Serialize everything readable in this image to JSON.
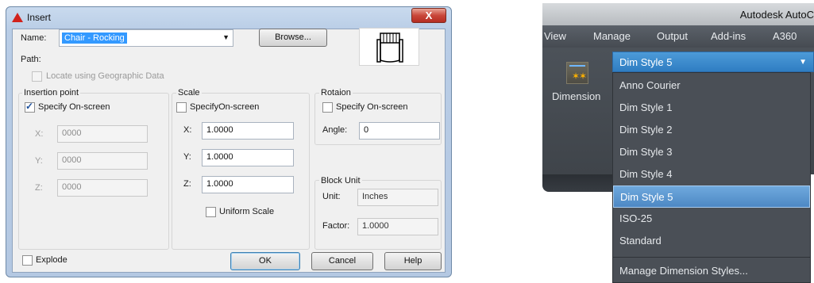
{
  "insert_dialog": {
    "title": "Insert",
    "close_glyph": "X",
    "name_label": "Name:",
    "name_value": "Chair - Rocking",
    "browse_button": "Browse...",
    "path_label": "Path:",
    "geo_checkbox": {
      "label": "Locate using Geographic Data",
      "checked": false,
      "enabled": false
    },
    "insertion_point": {
      "title": "Insertion point",
      "specify_label": "Specify On-screen",
      "specify_checked": true,
      "x_label": "X:",
      "x_value": "0000",
      "y_label": "Y:",
      "y_value": "0000",
      "z_label": "Z:",
      "z_value": "0000"
    },
    "scale": {
      "title": "Scale",
      "specify_label": "SpecifyOn-screen",
      "specify_checked": false,
      "x_label": "X:",
      "x_value": "1.0000",
      "y_label": "Y:",
      "y_value": "1.0000",
      "z_label": "Z:",
      "z_value": "1.0000",
      "uniform_label": "Uniform Scale",
      "uniform_checked": false
    },
    "rotation": {
      "title": "Rotaion",
      "specify_label": "Specify On-screen",
      "specify_checked": false,
      "angle_label": "Angle:",
      "angle_value": "0"
    },
    "block_unit": {
      "title": "Block Unit",
      "unit_label": "Unit:",
      "unit_value": "Inches",
      "factor_label": "Factor:",
      "factor_value": "1.0000"
    },
    "explode": {
      "label": "Explode",
      "checked": false
    },
    "buttons": {
      "ok": "OK",
      "cancel": "Cancel",
      "help": "Help"
    }
  },
  "ribbon": {
    "app_title": "Autodesk AutoC",
    "tabs": [
      "View",
      "Manage",
      "Output",
      "Add-ins",
      "A360"
    ],
    "panel_button_label": "Dimension",
    "dropdown": {
      "selected": "Dim Style 5",
      "items": [
        "Anno Courier",
        "Dim Style 1",
        "Dim Style 2",
        "Dim Style 3",
        "Dim Style 4",
        "Dim Style 5",
        "ISO-25",
        "Standard"
      ],
      "highlighted_index": 5,
      "footer": "Manage Dimension Styles..."
    }
  }
}
